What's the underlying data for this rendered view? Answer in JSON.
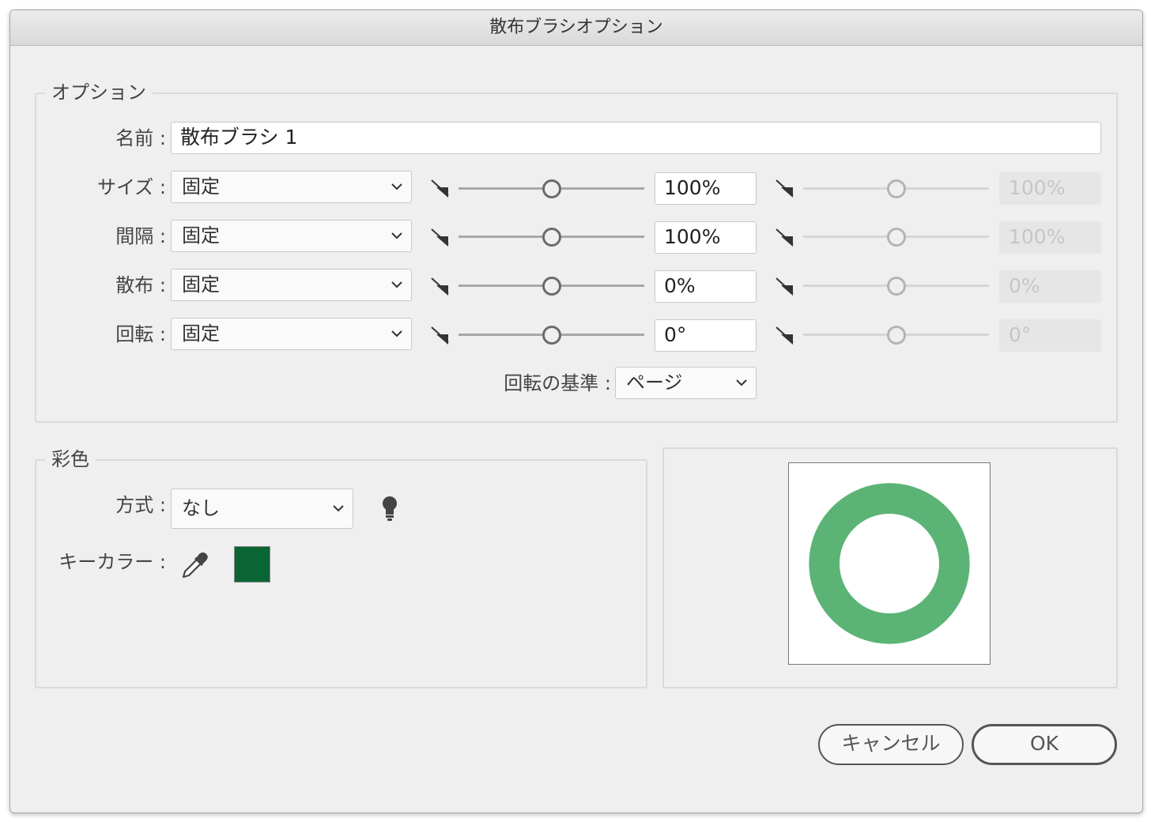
{
  "window": {
    "title": "散布ブラシオプション"
  },
  "options": {
    "legend": "オプション",
    "name_label": "名前 :",
    "name_value": "散布ブラシ 1",
    "rows": [
      {
        "label": "サイズ :",
        "method": "固定",
        "value": "100%",
        "value2": "100%",
        "slider_fraction": 0.5
      },
      {
        "label": "間隔 :",
        "method": "固定",
        "value": "100%",
        "value2": "100%",
        "slider_fraction": 0.5
      },
      {
        "label": "散布 :",
        "method": "固定",
        "value": "0%",
        "value2": "0%",
        "slider_fraction": 0.5
      },
      {
        "label": "回転 :",
        "method": "固定",
        "value": "0°",
        "value2": "0°",
        "slider_fraction": 0.5
      }
    ],
    "rotation_basis_label": "回転の基準 :",
    "rotation_basis_value": "ページ"
  },
  "colorization": {
    "legend": "彩色",
    "method_label": "方式 :",
    "method_value": "なし",
    "key_color_label": "キーカラー :",
    "key_color": "#0a6534"
  },
  "preview": {
    "ring_color": "#5bb475"
  },
  "buttons": {
    "cancel": "キャンセル",
    "ok": "OK"
  }
}
